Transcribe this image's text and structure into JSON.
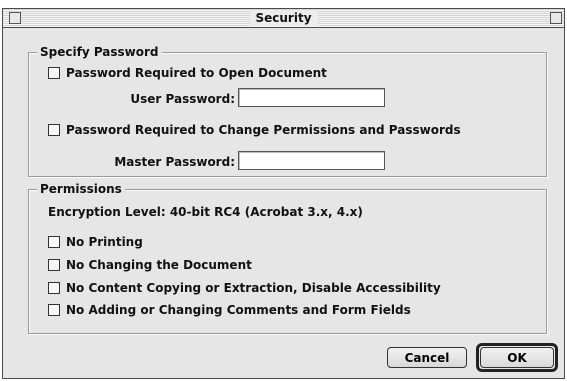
{
  "window": {
    "title": "Security"
  },
  "specify_password": {
    "legend": "Specify Password",
    "open_checkbox_label": "Password Required to Open Document",
    "user_password_label": "User Password:",
    "user_password_value": "",
    "permissions_checkbox_label": "Password Required to Change Permissions and Passwords",
    "master_password_label": "Master Password:",
    "master_password_value": ""
  },
  "permissions": {
    "legend": "Permissions",
    "encryption_level": "Encryption Level: 40-bit RC4 (Acrobat 3.x, 4.x)",
    "options": [
      {
        "label": "No Printing",
        "checked": false
      },
      {
        "label": "No Changing the Document",
        "checked": false
      },
      {
        "label": "No Content Copying or Extraction, Disable Accessibility",
        "checked": false
      },
      {
        "label": "No Adding or Changing Comments and Form Fields",
        "checked": false
      }
    ]
  },
  "buttons": {
    "cancel_label": "Cancel",
    "ok_label": "OK"
  }
}
